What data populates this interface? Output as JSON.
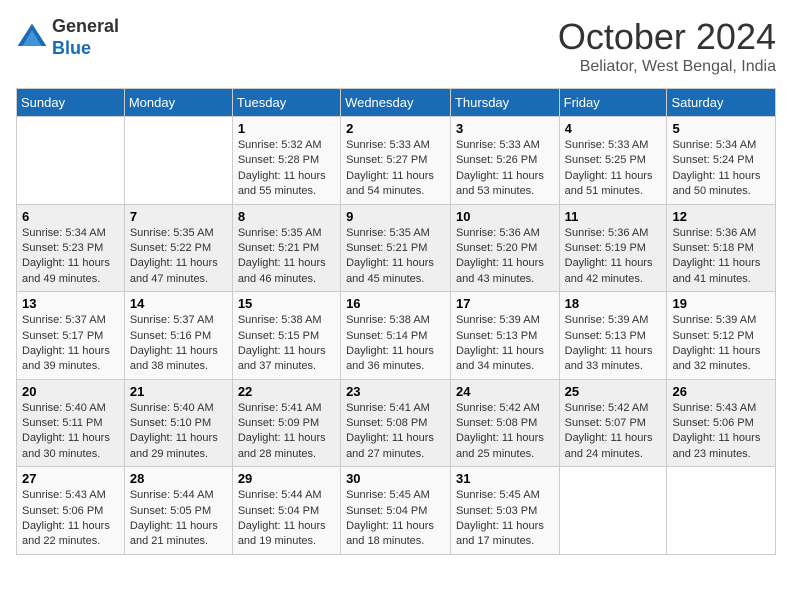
{
  "header": {
    "logo": {
      "line1": "General",
      "line2": "Blue"
    },
    "title": "October 2024",
    "location": "Beliator, West Bengal, India"
  },
  "calendar": {
    "days_of_week": [
      "Sunday",
      "Monday",
      "Tuesday",
      "Wednesday",
      "Thursday",
      "Friday",
      "Saturday"
    ],
    "weeks": [
      [
        {
          "day": "",
          "data": ""
        },
        {
          "day": "",
          "data": ""
        },
        {
          "day": "1",
          "sunrise": "Sunrise: 5:32 AM",
          "sunset": "Sunset: 5:28 PM",
          "daylight": "Daylight: 11 hours and 55 minutes."
        },
        {
          "day": "2",
          "sunrise": "Sunrise: 5:33 AM",
          "sunset": "Sunset: 5:27 PM",
          "daylight": "Daylight: 11 hours and 54 minutes."
        },
        {
          "day": "3",
          "sunrise": "Sunrise: 5:33 AM",
          "sunset": "Sunset: 5:26 PM",
          "daylight": "Daylight: 11 hours and 53 minutes."
        },
        {
          "day": "4",
          "sunrise": "Sunrise: 5:33 AM",
          "sunset": "Sunset: 5:25 PM",
          "daylight": "Daylight: 11 hours and 51 minutes."
        },
        {
          "day": "5",
          "sunrise": "Sunrise: 5:34 AM",
          "sunset": "Sunset: 5:24 PM",
          "daylight": "Daylight: 11 hours and 50 minutes."
        }
      ],
      [
        {
          "day": "6",
          "sunrise": "Sunrise: 5:34 AM",
          "sunset": "Sunset: 5:23 PM",
          "daylight": "Daylight: 11 hours and 49 minutes."
        },
        {
          "day": "7",
          "sunrise": "Sunrise: 5:35 AM",
          "sunset": "Sunset: 5:22 PM",
          "daylight": "Daylight: 11 hours and 47 minutes."
        },
        {
          "day": "8",
          "sunrise": "Sunrise: 5:35 AM",
          "sunset": "Sunset: 5:21 PM",
          "daylight": "Daylight: 11 hours and 46 minutes."
        },
        {
          "day": "9",
          "sunrise": "Sunrise: 5:35 AM",
          "sunset": "Sunset: 5:21 PM",
          "daylight": "Daylight: 11 hours and 45 minutes."
        },
        {
          "day": "10",
          "sunrise": "Sunrise: 5:36 AM",
          "sunset": "Sunset: 5:20 PM",
          "daylight": "Daylight: 11 hours and 43 minutes."
        },
        {
          "day": "11",
          "sunrise": "Sunrise: 5:36 AM",
          "sunset": "Sunset: 5:19 PM",
          "daylight": "Daylight: 11 hours and 42 minutes."
        },
        {
          "day": "12",
          "sunrise": "Sunrise: 5:36 AM",
          "sunset": "Sunset: 5:18 PM",
          "daylight": "Daylight: 11 hours and 41 minutes."
        }
      ],
      [
        {
          "day": "13",
          "sunrise": "Sunrise: 5:37 AM",
          "sunset": "Sunset: 5:17 PM",
          "daylight": "Daylight: 11 hours and 39 minutes."
        },
        {
          "day": "14",
          "sunrise": "Sunrise: 5:37 AM",
          "sunset": "Sunset: 5:16 PM",
          "daylight": "Daylight: 11 hours and 38 minutes."
        },
        {
          "day": "15",
          "sunrise": "Sunrise: 5:38 AM",
          "sunset": "Sunset: 5:15 PM",
          "daylight": "Daylight: 11 hours and 37 minutes."
        },
        {
          "day": "16",
          "sunrise": "Sunrise: 5:38 AM",
          "sunset": "Sunset: 5:14 PM",
          "daylight": "Daylight: 11 hours and 36 minutes."
        },
        {
          "day": "17",
          "sunrise": "Sunrise: 5:39 AM",
          "sunset": "Sunset: 5:13 PM",
          "daylight": "Daylight: 11 hours and 34 minutes."
        },
        {
          "day": "18",
          "sunrise": "Sunrise: 5:39 AM",
          "sunset": "Sunset: 5:13 PM",
          "daylight": "Daylight: 11 hours and 33 minutes."
        },
        {
          "day": "19",
          "sunrise": "Sunrise: 5:39 AM",
          "sunset": "Sunset: 5:12 PM",
          "daylight": "Daylight: 11 hours and 32 minutes."
        }
      ],
      [
        {
          "day": "20",
          "sunrise": "Sunrise: 5:40 AM",
          "sunset": "Sunset: 5:11 PM",
          "daylight": "Daylight: 11 hours and 30 minutes."
        },
        {
          "day": "21",
          "sunrise": "Sunrise: 5:40 AM",
          "sunset": "Sunset: 5:10 PM",
          "daylight": "Daylight: 11 hours and 29 minutes."
        },
        {
          "day": "22",
          "sunrise": "Sunrise: 5:41 AM",
          "sunset": "Sunset: 5:09 PM",
          "daylight": "Daylight: 11 hours and 28 minutes."
        },
        {
          "day": "23",
          "sunrise": "Sunrise: 5:41 AM",
          "sunset": "Sunset: 5:08 PM",
          "daylight": "Daylight: 11 hours and 27 minutes."
        },
        {
          "day": "24",
          "sunrise": "Sunrise: 5:42 AM",
          "sunset": "Sunset: 5:08 PM",
          "daylight": "Daylight: 11 hours and 25 minutes."
        },
        {
          "day": "25",
          "sunrise": "Sunrise: 5:42 AM",
          "sunset": "Sunset: 5:07 PM",
          "daylight": "Daylight: 11 hours and 24 minutes."
        },
        {
          "day": "26",
          "sunrise": "Sunrise: 5:43 AM",
          "sunset": "Sunset: 5:06 PM",
          "daylight": "Daylight: 11 hours and 23 minutes."
        }
      ],
      [
        {
          "day": "27",
          "sunrise": "Sunrise: 5:43 AM",
          "sunset": "Sunset: 5:06 PM",
          "daylight": "Daylight: 11 hours and 22 minutes."
        },
        {
          "day": "28",
          "sunrise": "Sunrise: 5:44 AM",
          "sunset": "Sunset: 5:05 PM",
          "daylight": "Daylight: 11 hours and 21 minutes."
        },
        {
          "day": "29",
          "sunrise": "Sunrise: 5:44 AM",
          "sunset": "Sunset: 5:04 PM",
          "daylight": "Daylight: 11 hours and 19 minutes."
        },
        {
          "day": "30",
          "sunrise": "Sunrise: 5:45 AM",
          "sunset": "Sunset: 5:04 PM",
          "daylight": "Daylight: 11 hours and 18 minutes."
        },
        {
          "day": "31",
          "sunrise": "Sunrise: 5:45 AM",
          "sunset": "Sunset: 5:03 PM",
          "daylight": "Daylight: 11 hours and 17 minutes."
        },
        {
          "day": "",
          "data": ""
        },
        {
          "day": "",
          "data": ""
        }
      ]
    ]
  }
}
